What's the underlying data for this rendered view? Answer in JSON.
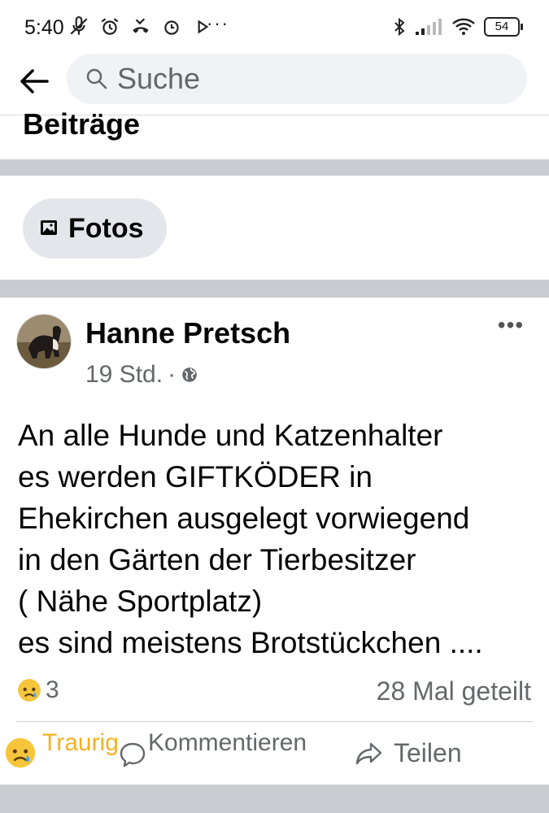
{
  "status_bar": {
    "time": "5:40",
    "more": "···",
    "battery": "54",
    "left_icons": [
      "muted-mic-icon",
      "alarm-icon",
      "missed-call-icon",
      "clock-icon",
      "play-icon"
    ],
    "right_icons": [
      "bluetooth-icon",
      "signal-icon",
      "wifi-icon",
      "battery-icon"
    ]
  },
  "header": {
    "back_icon": "arrow-left-icon",
    "search_placeholder": "Suche"
  },
  "section": {
    "title": "Beiträge",
    "chip_label": "Fotos",
    "chip_icon": "photo-icon"
  },
  "post": {
    "author": "Hanne Pretsch",
    "time": "19 Std.",
    "separator": "·",
    "privacy_icon": "globe-icon",
    "body_lines": [
      "An alle Hunde und Katzenhalter",
      "es werden GIFTKÖDER in",
      "Ehekirchen ausgelegt vorwiegend",
      "in den Gärten der Tierbesitzer",
      "( Nähe Sportplatz)",
      "es sind meistens Brotstückchen ...."
    ],
    "reaction_count": "3",
    "shares": "28 Mal geteilt",
    "actions": {
      "reaction": "Traurig",
      "comment": "Kommentieren",
      "share": "Teilen"
    }
  },
  "colors": {
    "accent_reaction": "#f7b125",
    "secondary_text": "#65676b",
    "divider": "#c9ccd1"
  }
}
